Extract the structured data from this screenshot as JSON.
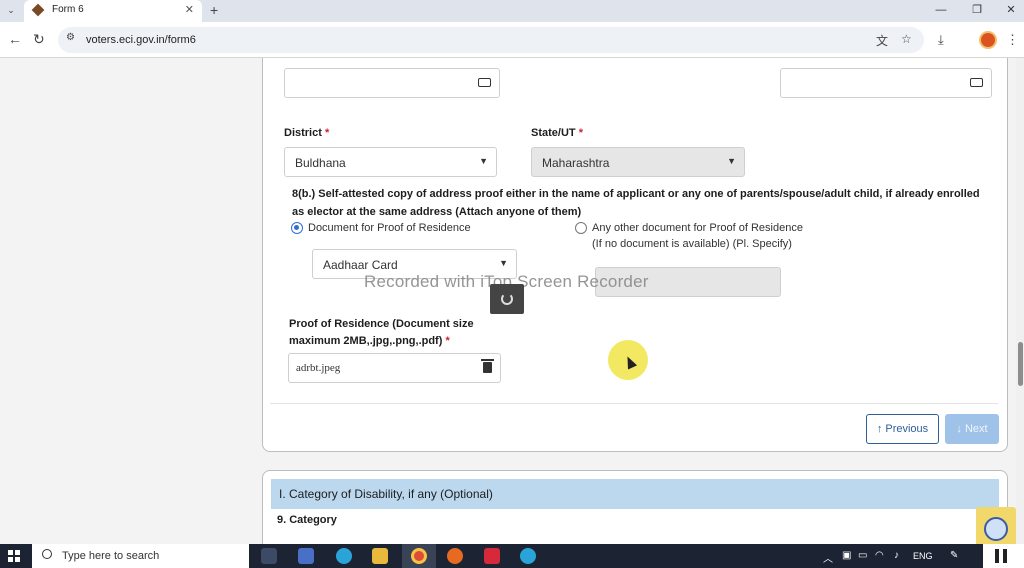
{
  "browser": {
    "tab_title": "Form 6",
    "tab_menu": "⌄",
    "tab_close": "✕",
    "new_tab": "+",
    "url": "voters.eci.gov.in/form6",
    "window_controls": {
      "minimize": "—",
      "restore": "❐",
      "close": "✕"
    }
  },
  "form": {
    "district_label": "District",
    "district_value": "Buldhana",
    "state_label": "State/UT",
    "state_value": "Maharashtra",
    "required_mark": "*",
    "address_proof_text": "8(b.) Self-attested copy of address proof either in the name of applicant or any one of parents/spouse/adult child, if already enrolled as elector at the same address (Attach anyone of them)",
    "radio_document_label": "Document for Proof of Residence",
    "radio_other_label_line1": "Any other document for Proof of Residence",
    "radio_other_label_line2": "(If no document is available) (Pl. Specify)",
    "document_type_value": "Aadhaar Card",
    "upload_label": "Proof of Residence (Document size maximum 2MB,.jpg,.png,.pdf)",
    "file_name": "adrbt.jpeg",
    "previous_button": "↑ Previous",
    "next_button": "↓ Next",
    "disability_section": "I. Category of Disability, if any (Optional)",
    "category_label": "9. Category"
  },
  "overlay": {
    "watermark": "Recorded with iTop Screen Recorder"
  },
  "taskbar": {
    "search_placeholder": "Type here to search",
    "language": "ENG"
  },
  "colors": {
    "accent_blue": "#2f6fd6",
    "required_red": "#d0202d",
    "section_header_bg": "#bcd8ee",
    "next_button_bg": "#9fc2e8"
  }
}
